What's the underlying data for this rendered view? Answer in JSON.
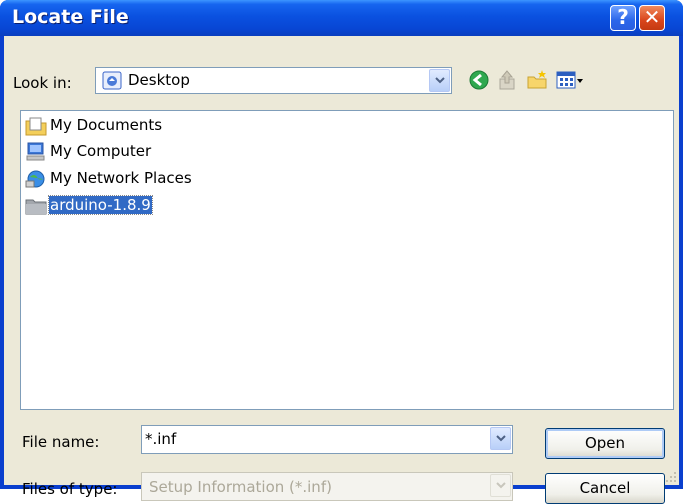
{
  "window": {
    "title": "Locate File",
    "help_label": "?",
    "close_label": "✕"
  },
  "toolbar": {
    "look_in_label": "Look in:",
    "look_in_value": "Desktop",
    "icons": [
      "back-icon",
      "up-folder-icon",
      "new-folder-icon",
      "view-menu-icon"
    ]
  },
  "files": [
    {
      "name": "My Documents",
      "icon": "documents-folder-icon"
    },
    {
      "name": "My Computer",
      "icon": "computer-icon"
    },
    {
      "name": "My Network Places",
      "icon": "network-places-icon"
    },
    {
      "name": "arduino-1.8.9",
      "icon": "folder-icon",
      "selected": true
    }
  ],
  "form": {
    "file_name_label": "File name:",
    "file_name_value": "*.inf",
    "file_type_label": "Files of type:",
    "file_type_value": "Setup Information (*.inf)"
  },
  "buttons": {
    "open": "Open",
    "cancel": "Cancel"
  },
  "colors": {
    "selection": "#316ac5",
    "title_bar": "#0a51e0",
    "dialog_bg": "#ece9d8"
  }
}
